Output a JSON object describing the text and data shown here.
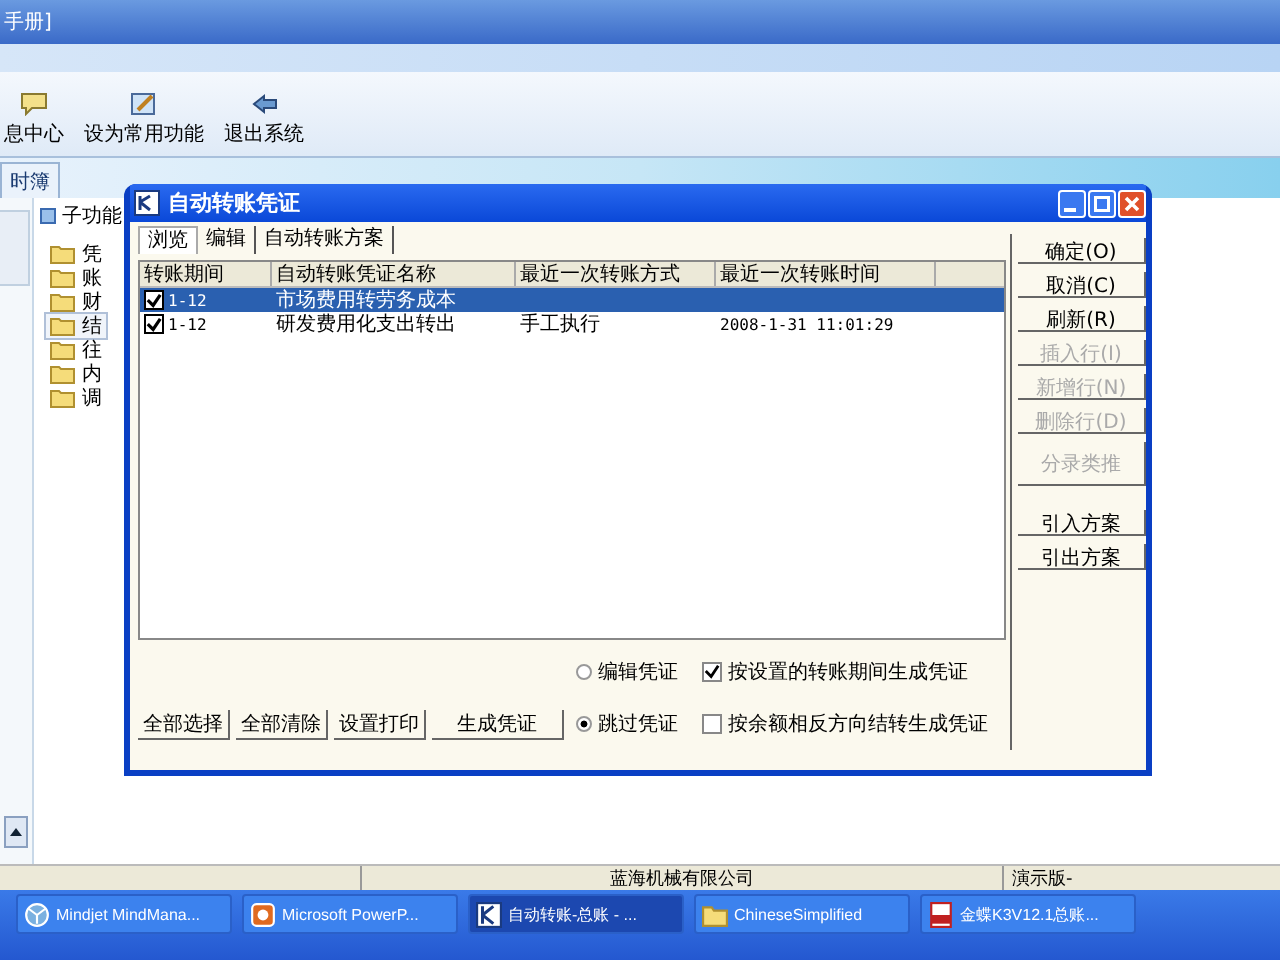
{
  "app_title": "手册]",
  "toolbar": [
    {
      "label": "息中心",
      "kind": "message"
    },
    {
      "label": "设为常用功能",
      "kind": "favorite"
    },
    {
      "label": "退出系统",
      "kind": "exit"
    }
  ],
  "module_tab": "时簿",
  "subfunction": {
    "title": "子功能",
    "items": [
      {
        "label": "凭",
        "selected": false
      },
      {
        "label": "账",
        "selected": false
      },
      {
        "label": "财",
        "selected": false
      },
      {
        "label": "结",
        "selected": true
      },
      {
        "label": "往",
        "selected": false
      },
      {
        "label": "内",
        "selected": false
      },
      {
        "label": "调",
        "selected": false
      }
    ]
  },
  "dialog": {
    "title": "自动转账凭证",
    "tabs": [
      {
        "label": "浏览",
        "selected": true
      },
      {
        "label": "编辑",
        "selected": false
      },
      {
        "label": "自动转账方案",
        "selected": false
      }
    ],
    "columns": [
      "转账期间",
      "自动转账凭证名称",
      "最近一次转账方式",
      "最近一次转账时间"
    ],
    "rows": [
      {
        "checked": true,
        "selected": true,
        "cells": [
          "1-12",
          "市场费用转劳务成本",
          "",
          ""
        ]
      },
      {
        "checked": true,
        "selected": false,
        "cells": [
          "1-12",
          "研发费用化支出转出",
          "手工执行",
          "2008-1-31 11:01:29"
        ]
      }
    ],
    "side_buttons": [
      {
        "label": "确定(O)",
        "disabled": false,
        "kind": "normal"
      },
      {
        "label": "取消(C)",
        "disabled": false,
        "kind": "normal"
      },
      {
        "label": "刷新(R)",
        "disabled": false,
        "kind": "normal"
      },
      {
        "label": "插入行(I)",
        "disabled": true,
        "kind": "normal"
      },
      {
        "label": "新增行(N)",
        "disabled": true,
        "kind": "normal"
      },
      {
        "label": "删除行(D)",
        "disabled": true,
        "kind": "normal"
      },
      {
        "label": "分录类推",
        "disabled": true,
        "kind": "tall"
      },
      {
        "label": "引入方案",
        "disabled": false,
        "kind": "spaced"
      },
      {
        "label": "引出方案",
        "disabled": false,
        "kind": "normal"
      }
    ],
    "bottom_buttons": [
      {
        "label": "全部选择",
        "kind": "normal"
      },
      {
        "label": "全部清除",
        "kind": "normal"
      },
      {
        "label": "设置打印",
        "kind": "normal"
      },
      {
        "label": "生成凭证",
        "kind": "wide"
      }
    ],
    "radios": [
      {
        "label": "编辑凭证",
        "selected": false
      },
      {
        "label": "跳过凭证",
        "selected": true
      }
    ],
    "checkboxes": [
      {
        "label": "按设置的转账期间生成凭证",
        "checked": true
      },
      {
        "label": "按余额相反方向结转生成凭证",
        "checked": false
      }
    ]
  },
  "status_bar": [
    "蓝海机械有限公司",
    "演示版-"
  ],
  "taskbar": [
    {
      "label": "Mindjet MindMana...",
      "selected": false,
      "kind": "mind"
    },
    {
      "label": "Microsoft PowerP...",
      "selected": false,
      "kind": "ppt"
    },
    {
      "label": "自动转账-总账 - ...",
      "selected": true,
      "kind": "k3"
    },
    {
      "label": "ChineseSimplified",
      "selected": false,
      "kind": "folder"
    },
    {
      "label": "金蝶K3V12.1总账...",
      "selected": false,
      "kind": "pdf"
    }
  ]
}
